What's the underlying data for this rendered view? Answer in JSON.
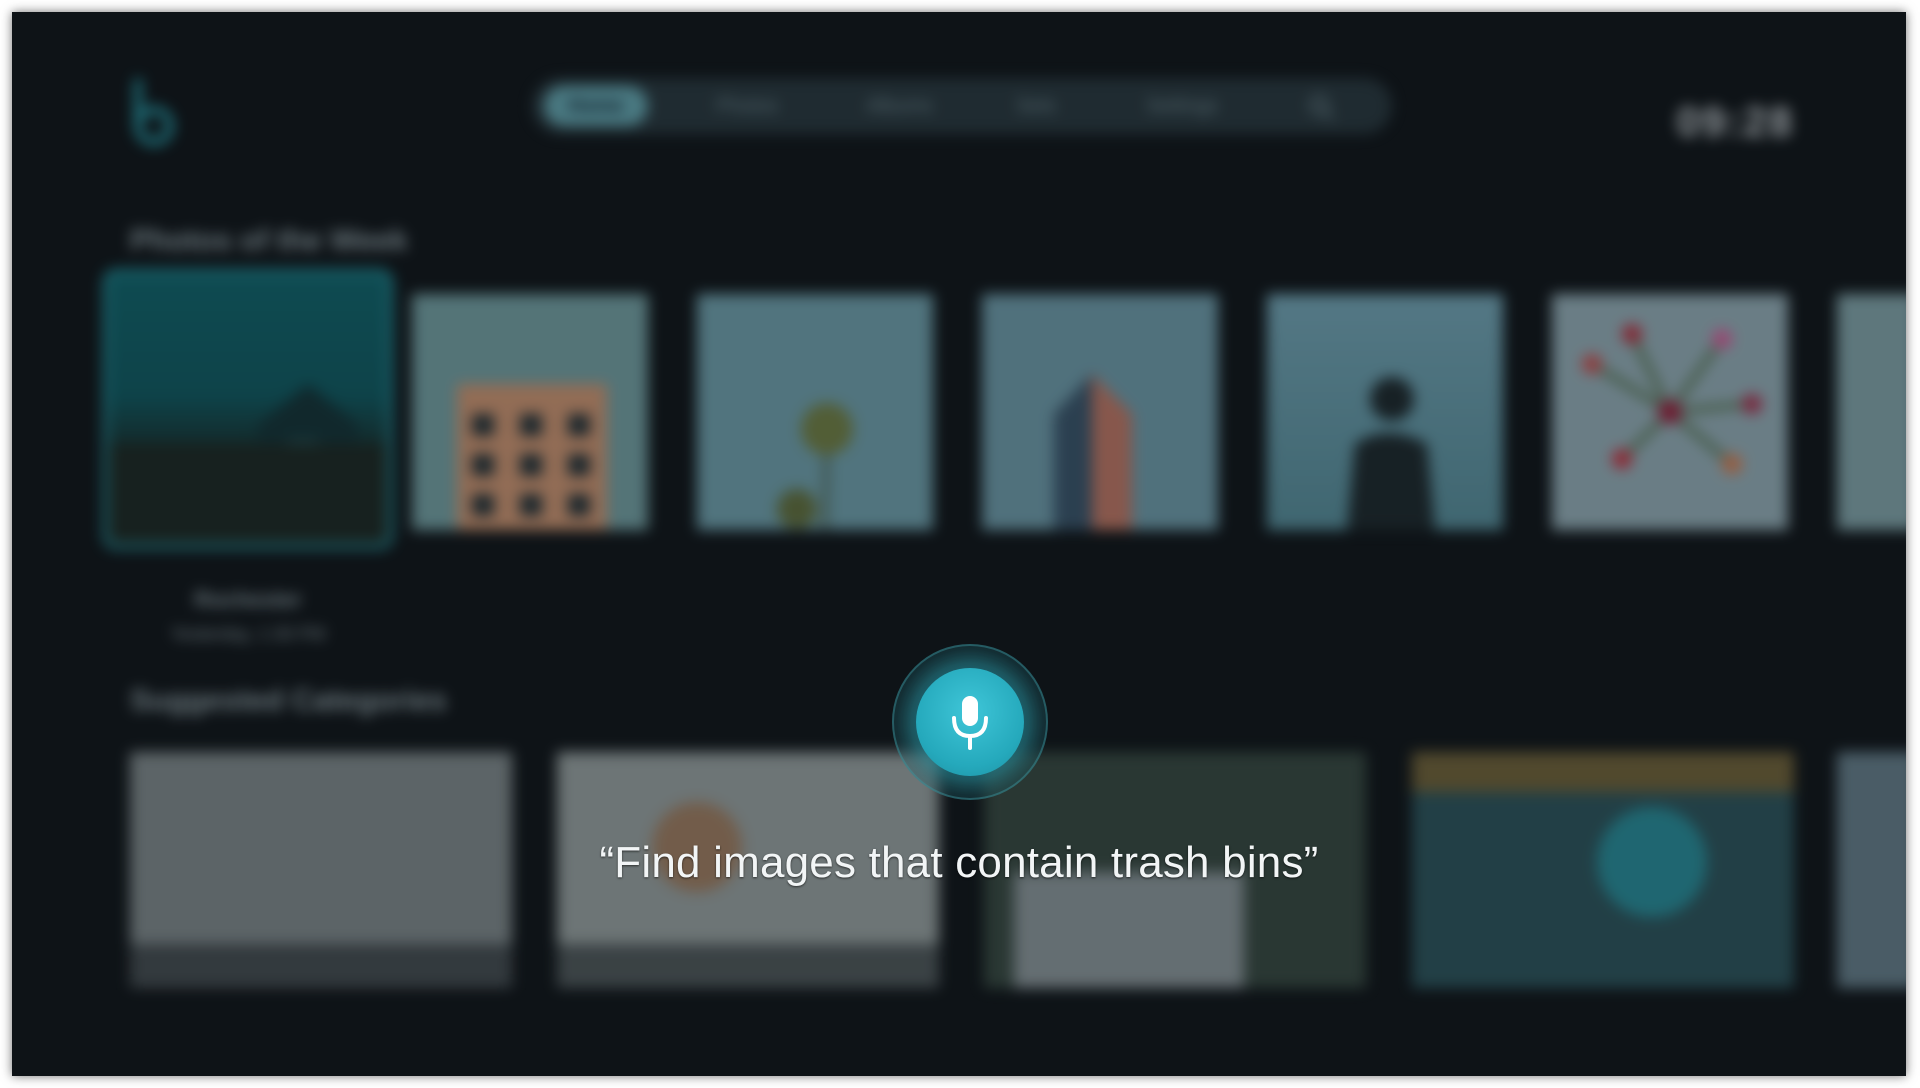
{
  "app": {
    "logo_icon": "b-logo-icon",
    "time": "09:28",
    "accent": "#2aa7b5"
  },
  "nav": {
    "tabs": [
      {
        "label": "Home",
        "active": true
      },
      {
        "label": "Photos"
      },
      {
        "label": "Albums"
      },
      {
        "label": "Sets"
      },
      {
        "label": "Settings"
      }
    ],
    "search_icon": "search-icon"
  },
  "photos_section": {
    "title": "Photos of the Week",
    "focused_caption_title": "Rochester",
    "focused_caption_subtitle": "Yesterday, 1:30 PM"
  },
  "categories_section": {
    "title": "Suggested Categories"
  },
  "voice": {
    "mic_icon": "microphone-icon",
    "utterance": "“Find images that contain trash bins”"
  }
}
